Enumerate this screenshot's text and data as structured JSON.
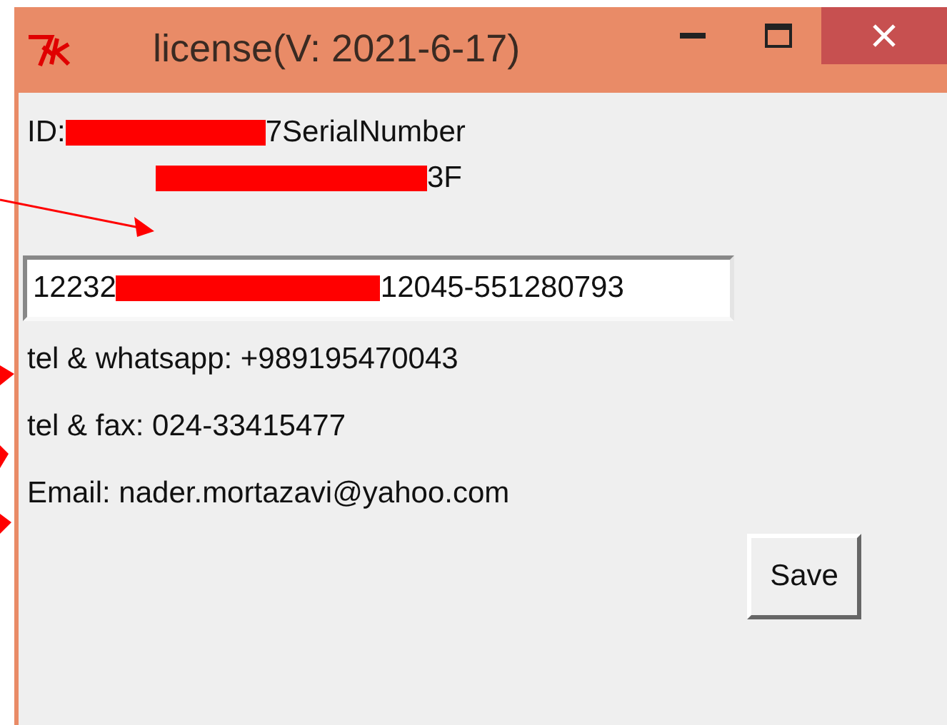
{
  "window": {
    "title": "license(V: 2021-6-17)"
  },
  "id_line": [
    {
      "kind": "text",
      "text": "ID:"
    },
    {
      "kind": "redaction"
    },
    {
      "kind": "text",
      "text": "7SerialNumber"
    }
  ],
  "serial_line": [
    {
      "kind": "redaction"
    },
    {
      "kind": "text",
      "text": "3F"
    }
  ],
  "license_field": [
    {
      "kind": "text",
      "text": "12232"
    },
    {
      "kind": "redaction"
    },
    {
      "kind": "text",
      "text": "12045-551280793"
    }
  ],
  "contacts": [
    "tel & whatsapp: +989195470043",
    "tel & fax: 024-33415477",
    "Email: nader.mortazavi@yahoo.com"
  ],
  "buttons": [
    {
      "label": "Save"
    }
  ]
}
